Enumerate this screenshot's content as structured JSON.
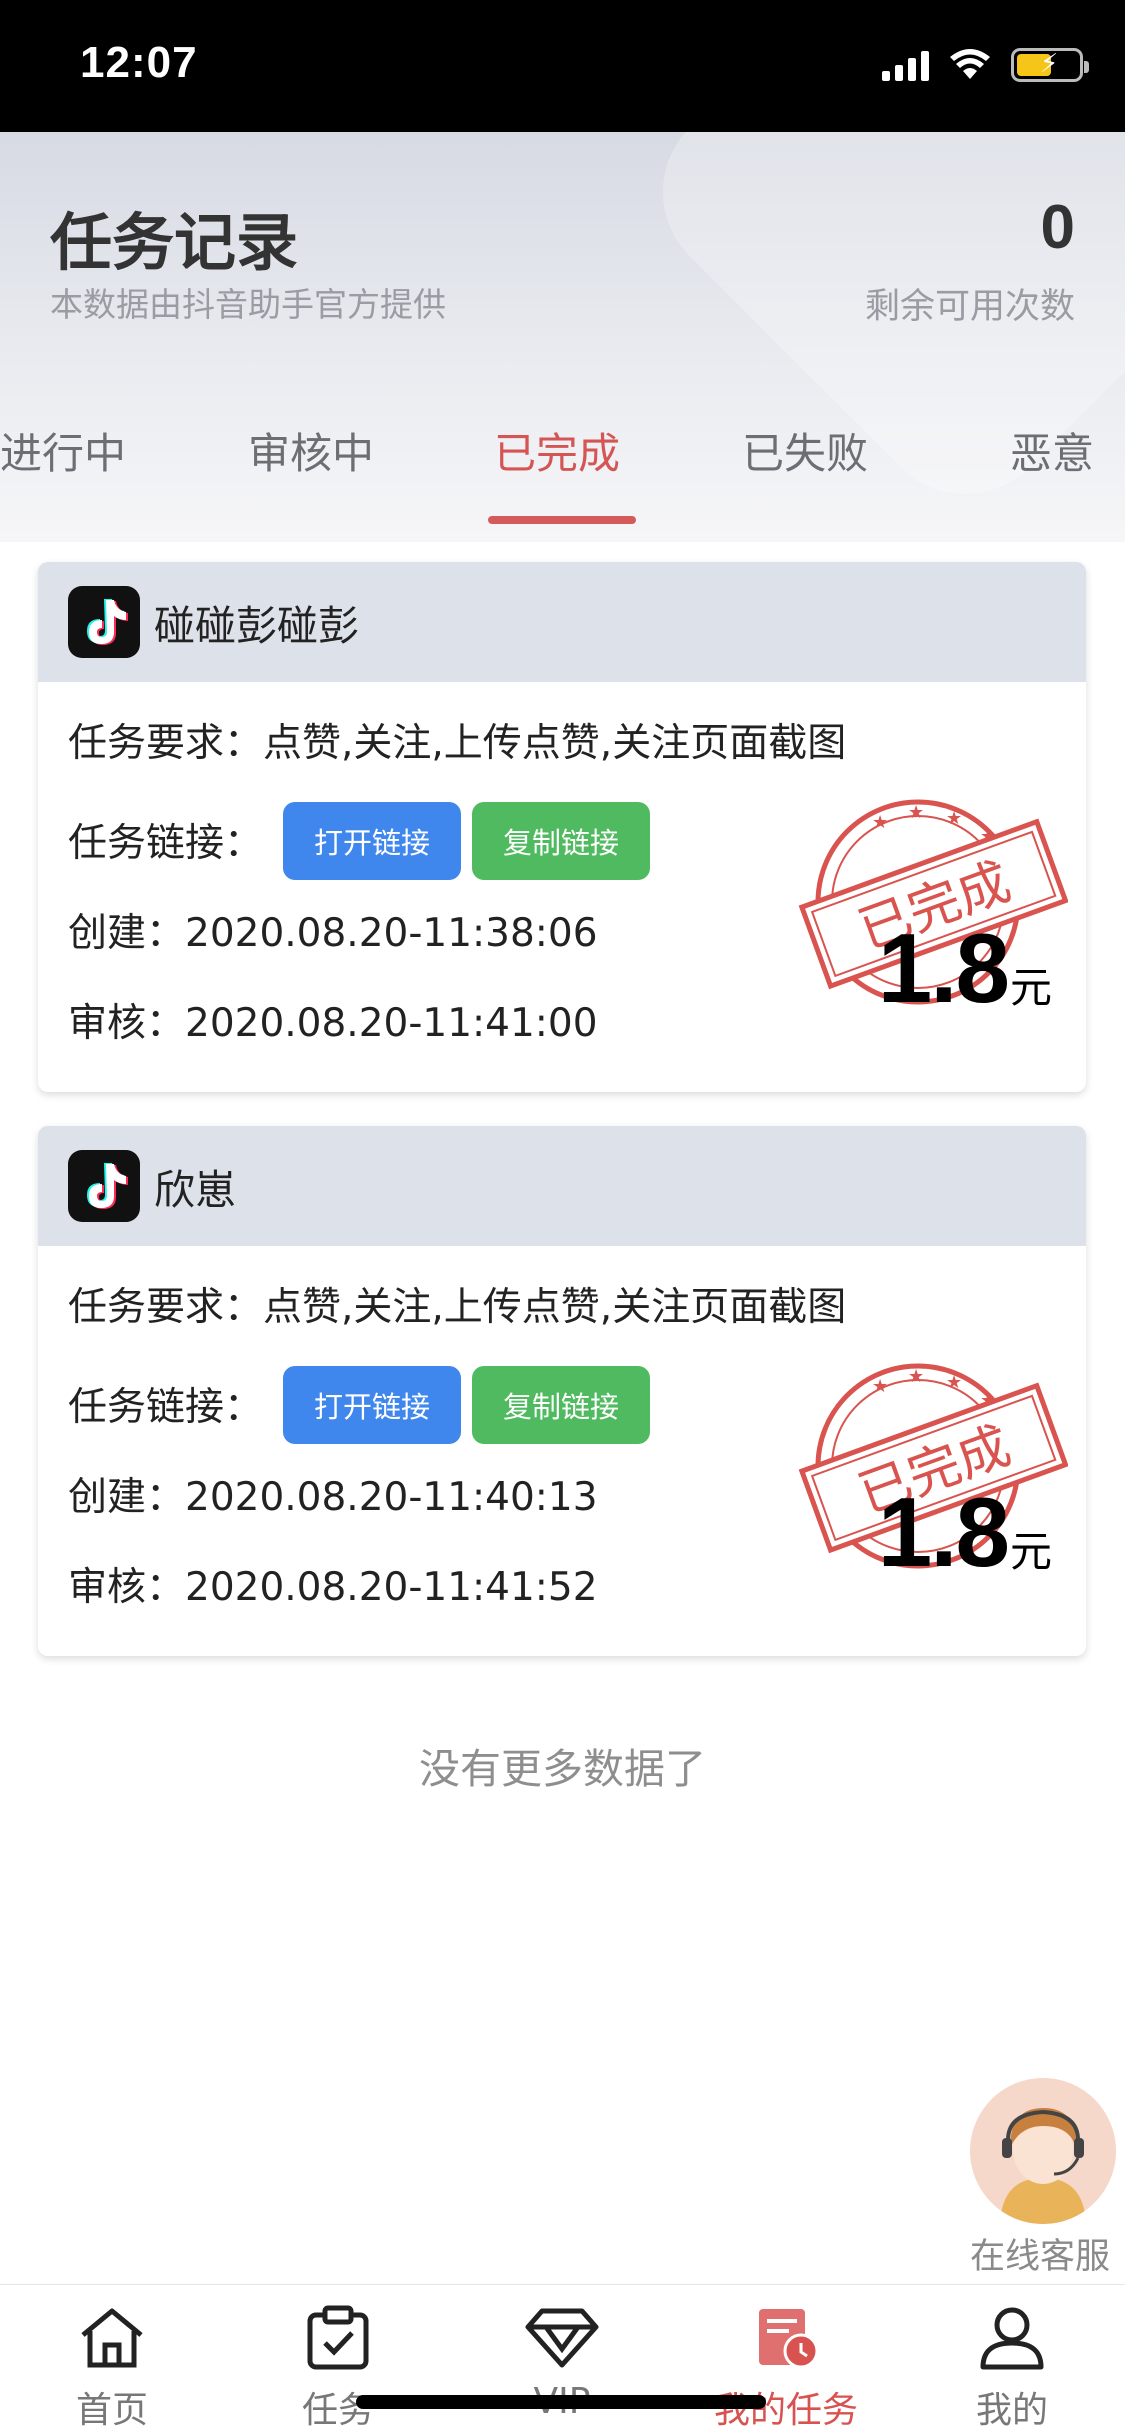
{
  "status_bar": {
    "time": "12:07"
  },
  "header": {
    "title": "任务记录",
    "subtitle": "本数据由抖音助手官方提供",
    "remain_count": "0",
    "remain_label": "剩余可用次数"
  },
  "tabs": [
    {
      "label": "进行中",
      "active": false
    },
    {
      "label": "审核中",
      "active": false
    },
    {
      "label": "已完成",
      "active": true
    },
    {
      "label": "已失败",
      "active": false
    },
    {
      "label": "恶意",
      "active": false
    }
  ],
  "cards": [
    {
      "name": "碰碰彭碰彭",
      "requirement_label": "任务要求：",
      "requirement": "点赞,关注,上传点赞,关注页面截图",
      "link_label": "任务链接：",
      "open_link": "打开链接",
      "copy_link": "复制链接",
      "created_label": "创建：",
      "created": "2020.08.20-11:38:06",
      "reviewed_label": "审核：",
      "reviewed": "2020.08.20-11:41:00",
      "stamp": "已完成",
      "reward": "1.8",
      "reward_unit": "元"
    },
    {
      "name": "欣崽",
      "requirement_label": "任务要求：",
      "requirement": "点赞,关注,上传点赞,关注页面截图",
      "link_label": "任务链接：",
      "open_link": "打开链接",
      "copy_link": "复制链接",
      "created_label": "创建：",
      "created": "2020.08.20-11:40:13",
      "reviewed_label": "审核：",
      "reviewed": "2020.08.20-11:41:52",
      "stamp": "已完成",
      "reward": "1.8",
      "reward_unit": "元"
    }
  ],
  "no_more": "没有更多数据了",
  "service": {
    "label": "在线客服"
  },
  "bottom_nav": [
    {
      "label": "首页",
      "icon": "home-icon",
      "active": false
    },
    {
      "label": "任务",
      "icon": "clipboard-check-icon",
      "active": false
    },
    {
      "label": "VIP",
      "icon": "diamond-icon",
      "active": false
    },
    {
      "label": "我的任务",
      "icon": "task-clock-icon",
      "active": true
    },
    {
      "label": "我的",
      "icon": "user-icon",
      "active": false
    }
  ],
  "colors": {
    "accent": "#d55555",
    "open_button": "#3f87ec",
    "copy_button": "#4fba5f",
    "stamp": "#d9534f"
  }
}
